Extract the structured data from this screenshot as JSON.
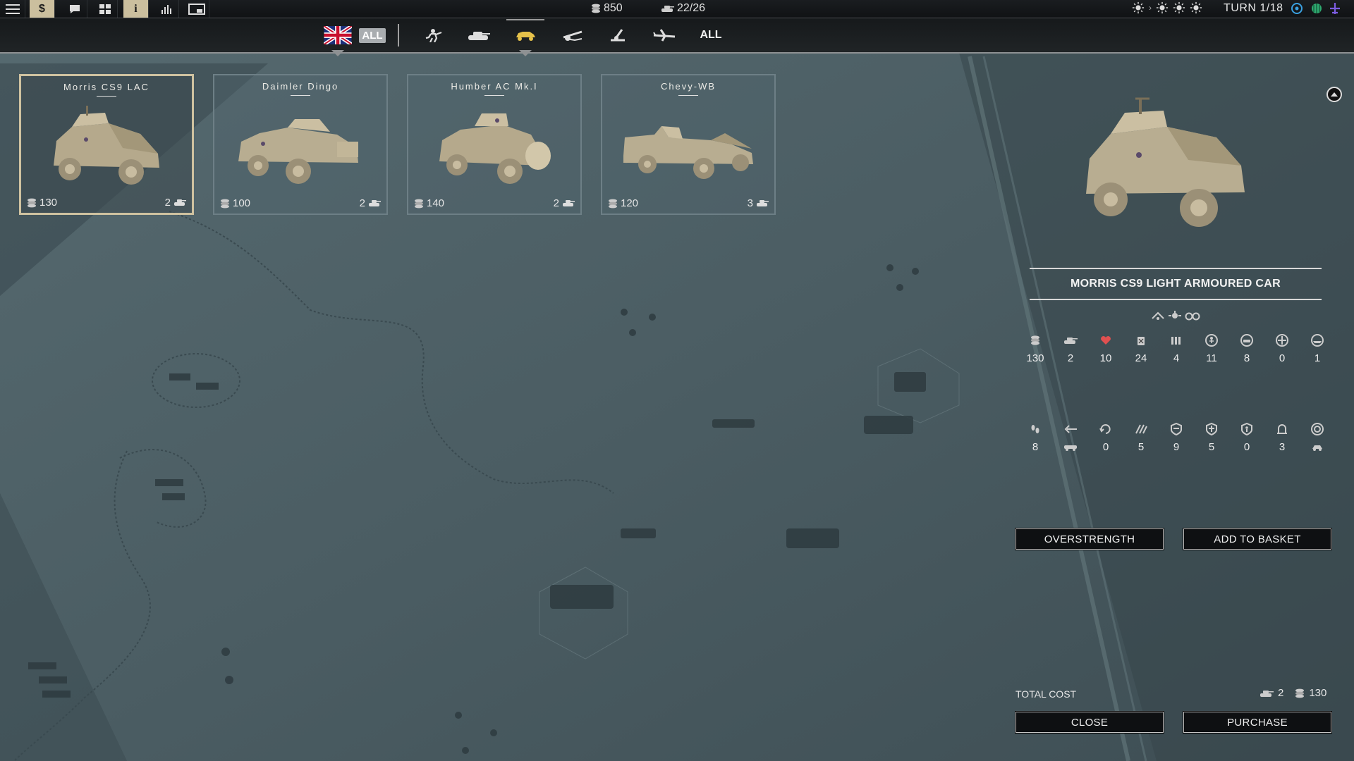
{
  "topbar": {
    "money": "850",
    "units": "22/26",
    "turn": "TURN 1/18"
  },
  "filter": {
    "faction_all": "ALL",
    "all_label": "ALL",
    "categories": [
      "infantry",
      "tanks",
      "recon",
      "artillery",
      "anti-air",
      "aircraft"
    ]
  },
  "cards": [
    {
      "name": "Morris CS9 LAC",
      "cost": "130",
      "slots": "2"
    },
    {
      "name": "Daimler Dingo",
      "cost": "100",
      "slots": "2"
    },
    {
      "name": "Humber AC Mk.I",
      "cost": "140",
      "slots": "2"
    },
    {
      "name": "Chevy-WB",
      "cost": "120",
      "slots": "3"
    }
  ],
  "detail": {
    "title": "MORRIS CS9 LIGHT ARMOURED CAR",
    "stats_row1": [
      "130",
      "2",
      "10",
      "24",
      "4",
      "11",
      "8",
      "0",
      "1"
    ],
    "stats_row2": [
      "8",
      "",
      "0",
      "5",
      "9",
      "5",
      "0",
      "3",
      ""
    ],
    "overstrength": "OVERSTRENGTH",
    "add_to_basket": "ADD TO BASKET",
    "total_cost_label": "TOTAL COST",
    "total_slots": "2",
    "total_money": "130",
    "close": "CLOSE",
    "purchase": "PURCHASE"
  },
  "colors": {
    "accent_tan": "#cbbf9e",
    "heart_red": "#e05050",
    "card_border": "#6d7f86"
  }
}
